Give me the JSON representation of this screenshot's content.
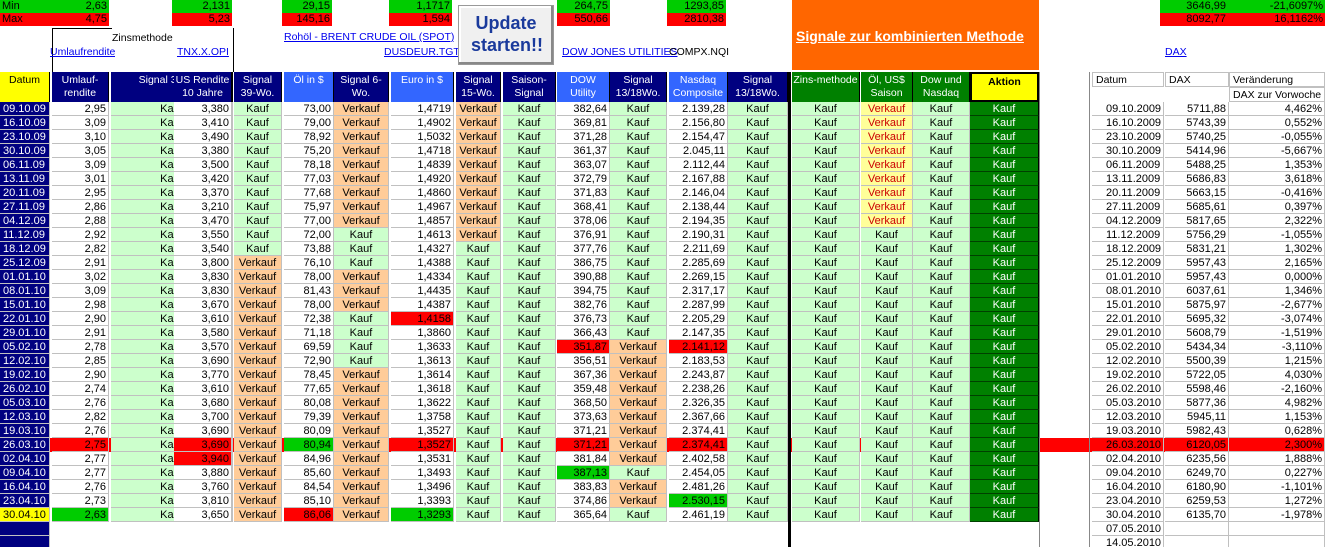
{
  "top": {
    "min_label": "Min",
    "max_label": "Max",
    "min_vals": [
      "2,63",
      "2,131",
      "29,15",
      "1,1717",
      "264,75",
      "1293,85",
      "3646,99",
      "-21,6097%"
    ],
    "max_vals": [
      "4,75",
      "5,23",
      "145,16",
      "1,594",
      "550,66",
      "2810,38",
      "8092,77",
      "16,1162%"
    ],
    "zins_label": "Zinsmethode",
    "links": [
      "Umlaufrendite",
      "TNX.X.OPI",
      "Rohöl - BRENT CRUDE OIL (SPOT)",
      "DUSDEUR.TGT",
      "DOW JONES UTILITIES",
      "COMPX.NQI",
      "DAX"
    ],
    "update_button_label": "Update starten!!",
    "signale_label": "Signale zur kombinierten Methode"
  },
  "headers": [
    "Datum",
    "Umlauf-rendite",
    "Signal 39-Wo.",
    "US Rendite 10 Jahre",
    "Signal 39-Wo.",
    "Öl in $",
    "Signal 6-Wo.",
    "Euro in $",
    "Signal 15-Wo.",
    "Saison-Signal",
    "DOW Utility",
    "Signal 13/18Wo.",
    "Nasdaq Composite",
    "Signal 13/18Wo.",
    "Zins-methode",
    "Öl, US$ Saison",
    "Dow und Nasdaq",
    "Aktion"
  ],
  "dax_headers": [
    "Datum",
    "DAX",
    "Veränderung",
    "DAX zur Vorwoche"
  ],
  "rows": [
    [
      "09.10.09",
      "2,95",
      "Kauf",
      "3,380",
      "Kauf",
      "73,00",
      "Verkauf",
      "1,4719",
      "Verkauf",
      "Kauf",
      "382,64",
      "Kauf",
      "2.139,28",
      "Kauf",
      "Kauf",
      "Verkauf",
      "Kauf",
      "Kauf"
    ],
    [
      "16.10.09",
      "3,09",
      "Kauf",
      "3,410",
      "Kauf",
      "79,00",
      "Verkauf",
      "1,4902",
      "Verkauf",
      "Kauf",
      "369,81",
      "Kauf",
      "2.156,80",
      "Kauf",
      "Kauf",
      "Verkauf",
      "Kauf",
      "Kauf"
    ],
    [
      "23.10.09",
      "3,10",
      "Kauf",
      "3,490",
      "Kauf",
      "78,92",
      "Verkauf",
      "1,5032",
      "Verkauf",
      "Kauf",
      "371,28",
      "Kauf",
      "2.154,47",
      "Kauf",
      "Kauf",
      "Verkauf",
      "Kauf",
      "Kauf"
    ],
    [
      "30.10.09",
      "3,05",
      "Kauf",
      "3,380",
      "Kauf",
      "75,20",
      "Verkauf",
      "1,4718",
      "Verkauf",
      "Kauf",
      "361,37",
      "Kauf",
      "2.045,11",
      "Kauf",
      "Kauf",
      "Verkauf",
      "Kauf",
      "Kauf"
    ],
    [
      "06.11.09",
      "3,09",
      "Kauf",
      "3,500",
      "Kauf",
      "78,18",
      "Verkauf",
      "1,4839",
      "Verkauf",
      "Kauf",
      "363,07",
      "Kauf",
      "2.112,44",
      "Kauf",
      "Kauf",
      "Verkauf",
      "Kauf",
      "Kauf"
    ],
    [
      "13.11.09",
      "3,01",
      "Kauf",
      "3,420",
      "Kauf",
      "77,03",
      "Verkauf",
      "1,4920",
      "Verkauf",
      "Kauf",
      "372,79",
      "Kauf",
      "2.167,88",
      "Kauf",
      "Kauf",
      "Verkauf",
      "Kauf",
      "Kauf"
    ],
    [
      "20.11.09",
      "2,95",
      "Kauf",
      "3,370",
      "Kauf",
      "77,68",
      "Verkauf",
      "1,4860",
      "Verkauf",
      "Kauf",
      "371,83",
      "Kauf",
      "2.146,04",
      "Kauf",
      "Kauf",
      "Verkauf",
      "Kauf",
      "Kauf"
    ],
    [
      "27.11.09",
      "2,86",
      "Kauf",
      "3,210",
      "Kauf",
      "75,97",
      "Verkauf",
      "1,4967",
      "Verkauf",
      "Kauf",
      "368,41",
      "Kauf",
      "2.138,44",
      "Kauf",
      "Kauf",
      "Verkauf",
      "Kauf",
      "Kauf"
    ],
    [
      "04.12.09",
      "2,88",
      "Kauf",
      "3,470",
      "Kauf",
      "77,00",
      "Verkauf",
      "1,4857",
      "Verkauf",
      "Kauf",
      "378,06",
      "Kauf",
      "2.194,35",
      "Kauf",
      "Kauf",
      "Verkauf",
      "Kauf",
      "Kauf"
    ],
    [
      "11.12.09",
      "2,92",
      "Kauf",
      "3,550",
      "Kauf",
      "72,00",
      "Kauf",
      "1,4613",
      "Verkauf",
      "Kauf",
      "376,91",
      "Kauf",
      "2.190,31",
      "Kauf",
      "Kauf",
      "Kauf",
      "Kauf",
      "Kauf"
    ],
    [
      "18.12.09",
      "2,82",
      "Kauf",
      "3,540",
      "Kauf",
      "73,88",
      "Kauf",
      "1,4327",
      "Kauf",
      "Kauf",
      "377,76",
      "Kauf",
      "2.211,69",
      "Kauf",
      "Kauf",
      "Kauf",
      "Kauf",
      "Kauf"
    ],
    [
      "25.12.09",
      "2,91",
      "Kauf",
      "3,800",
      "Verkauf",
      "76,10",
      "Kauf",
      "1,4388",
      "Kauf",
      "Kauf",
      "386,75",
      "Kauf",
      "2.285,69",
      "Kauf",
      "Kauf",
      "Kauf",
      "Kauf",
      "Kauf"
    ],
    [
      "01.01.10",
      "3,02",
      "Kauf",
      "3,830",
      "Verkauf",
      "78,00",
      "Verkauf",
      "1,4334",
      "Kauf",
      "Kauf",
      "390,88",
      "Kauf",
      "2.269,15",
      "Kauf",
      "Kauf",
      "Kauf",
      "Kauf",
      "Kauf"
    ],
    [
      "08.01.10",
      "3,09",
      "Kauf",
      "3,830",
      "Verkauf",
      "81,43",
      "Verkauf",
      "1,4435",
      "Kauf",
      "Kauf",
      "394,75",
      "Kauf",
      "2.317,17",
      "Kauf",
      "Kauf",
      "Kauf",
      "Kauf",
      "Kauf"
    ],
    [
      "15.01.10",
      "2,98",
      "Kauf",
      "3,670",
      "Verkauf",
      "78,00",
      "Verkauf",
      "1,4387",
      "Kauf",
      "Kauf",
      "382,76",
      "Kauf",
      "2.287,99",
      "Kauf",
      "Kauf",
      "Kauf",
      "Kauf",
      "Kauf"
    ],
    [
      "22.01.10",
      "2,90",
      "Kauf",
      "3,610",
      "Verkauf",
      "72,38",
      "Kauf",
      "1,4158",
      "Kauf",
      "Kauf",
      "376,73",
      "Kauf",
      "2.205,29",
      "Kauf",
      "Kauf",
      "Kauf",
      "Kauf",
      "Kauf"
    ],
    [
      "29.01.10",
      "2,91",
      "Kauf",
      "3,580",
      "Verkauf",
      "71,18",
      "Kauf",
      "1,3860",
      "Kauf",
      "Kauf",
      "366,43",
      "Kauf",
      "2.147,35",
      "Kauf",
      "Kauf",
      "Kauf",
      "Kauf",
      "Kauf"
    ],
    [
      "05.02.10",
      "2,78",
      "Kauf",
      "3,570",
      "Verkauf",
      "69,59",
      "Kauf",
      "1,3633",
      "Kauf",
      "Kauf",
      "351,87",
      "Verkauf",
      "2.141,12",
      "Kauf",
      "Kauf",
      "Kauf",
      "Kauf",
      "Kauf"
    ],
    [
      "12.02.10",
      "2,85",
      "Kauf",
      "3,690",
      "Verkauf",
      "72,90",
      "Kauf",
      "1,3613",
      "Kauf",
      "Kauf",
      "356,51",
      "Verkauf",
      "2.183,53",
      "Kauf",
      "Kauf",
      "Kauf",
      "Kauf",
      "Kauf"
    ],
    [
      "19.02.10",
      "2,90",
      "Kauf",
      "3,770",
      "Verkauf",
      "78,45",
      "Verkauf",
      "1,3614",
      "Kauf",
      "Kauf",
      "367,36",
      "Verkauf",
      "2.243,87",
      "Kauf",
      "Kauf",
      "Kauf",
      "Kauf",
      "Kauf"
    ],
    [
      "26.02.10",
      "2,74",
      "Kauf",
      "3,610",
      "Verkauf",
      "77,65",
      "Verkauf",
      "1,3618",
      "Kauf",
      "Kauf",
      "359,48",
      "Verkauf",
      "2.238,26",
      "Kauf",
      "Kauf",
      "Kauf",
      "Kauf",
      "Kauf"
    ],
    [
      "05.03.10",
      "2,76",
      "Kauf",
      "3,680",
      "Verkauf",
      "80,08",
      "Verkauf",
      "1,3622",
      "Kauf",
      "Kauf",
      "368,50",
      "Verkauf",
      "2.326,35",
      "Kauf",
      "Kauf",
      "Kauf",
      "Kauf",
      "Kauf"
    ],
    [
      "12.03.10",
      "2,82",
      "Kauf",
      "3,700",
      "Verkauf",
      "79,39",
      "Verkauf",
      "1,3758",
      "Kauf",
      "Kauf",
      "373,63",
      "Verkauf",
      "2.367,66",
      "Kauf",
      "Kauf",
      "Kauf",
      "Kauf",
      "Kauf"
    ],
    [
      "19.03.10",
      "2,76",
      "Kauf",
      "3,690",
      "Verkauf",
      "80,09",
      "Verkauf",
      "1,3527",
      "Kauf",
      "Kauf",
      "371,21",
      "Verkauf",
      "2.374,41",
      "Kauf",
      "Kauf",
      "Kauf",
      "Kauf",
      "Kauf"
    ],
    [
      "26.03.10",
      "2,75",
      "Kauf",
      "3,690",
      "Verkauf",
      "80,94",
      "Verkauf",
      "1,3527",
      "Kauf",
      "Kauf",
      "371,21",
      "Verkauf",
      "2.374,41",
      "Kauf",
      "Kauf",
      "Kauf",
      "Kauf",
      "Kauf"
    ],
    [
      "02.04.10",
      "2,77",
      "Kauf",
      "3,940",
      "Verkauf",
      "84,96",
      "Verkauf",
      "1,3531",
      "Kauf",
      "Kauf",
      "381,84",
      "Verkauf",
      "2.402,58",
      "Kauf",
      "Kauf",
      "Kauf",
      "Kauf",
      "Kauf"
    ],
    [
      "09.04.10",
      "2,77",
      "Kauf",
      "3,880",
      "Verkauf",
      "85,60",
      "Verkauf",
      "1,3493",
      "Kauf",
      "Kauf",
      "387,13",
      "Kauf",
      "2.454,05",
      "Kauf",
      "Kauf",
      "Kauf",
      "Kauf",
      "Kauf"
    ],
    [
      "16.04.10",
      "2,76",
      "Kauf",
      "3,760",
      "Verkauf",
      "84,54",
      "Verkauf",
      "1,3496",
      "Kauf",
      "Kauf",
      "383,83",
      "Verkauf",
      "2.481,26",
      "Kauf",
      "Kauf",
      "Kauf",
      "Kauf",
      "Kauf"
    ],
    [
      "23.04.10",
      "2,73",
      "Kauf",
      "3,810",
      "Verkauf",
      "85,10",
      "Verkauf",
      "1,3393",
      "Kauf",
      "Kauf",
      "374,86",
      "Verkauf",
      "2.530,15",
      "Kauf",
      "Kauf",
      "Kauf",
      "Kauf",
      "Kauf"
    ],
    [
      "30.04.10",
      "2,63",
      "Kauf",
      "3,650",
      "Verkauf",
      "86,06",
      "Verkauf",
      "1,3293",
      "Kauf",
      "Kauf",
      "365,64",
      "Kauf",
      "2.461,19",
      "Kauf",
      "Kauf",
      "Kauf",
      "Kauf",
      "Kauf"
    ]
  ],
  "dax_rows": [
    [
      "09.10.2009",
      "5711,88",
      "4,462%"
    ],
    [
      "16.10.2009",
      "5743,39",
      "0,552%"
    ],
    [
      "23.10.2009",
      "5740,25",
      "-0,055%"
    ],
    [
      "30.10.2009",
      "5414,96",
      "-5,667%"
    ],
    [
      "06.11.2009",
      "5488,25",
      "1,353%"
    ],
    [
      "13.11.2009",
      "5686,83",
      "3,618%"
    ],
    [
      "20.11.2009",
      "5663,15",
      "-0,416%"
    ],
    [
      "27.11.2009",
      "5685,61",
      "0,397%"
    ],
    [
      "04.12.2009",
      "5817,65",
      "2,322%"
    ],
    [
      "11.12.2009",
      "5756,29",
      "-1,055%"
    ],
    [
      "18.12.2009",
      "5831,21",
      "1,302%"
    ],
    [
      "25.12.2009",
      "5957,43",
      "2,165%"
    ],
    [
      "01.01.2010",
      "5957,43",
      "0,000%"
    ],
    [
      "08.01.2010",
      "6037,61",
      "1,346%"
    ],
    [
      "15.01.2010",
      "5875,97",
      "-2,677%"
    ],
    [
      "22.01.2010",
      "5695,32",
      "-3,074%"
    ],
    [
      "29.01.2010",
      "5608,79",
      "-1,519%"
    ],
    [
      "05.02.2010",
      "5434,34",
      "-3,110%"
    ],
    [
      "12.02.2010",
      "5500,39",
      "1,215%"
    ],
    [
      "19.02.2010",
      "5722,05",
      "4,030%"
    ],
    [
      "26.02.2010",
      "5598,46",
      "-2,160%"
    ],
    [
      "05.03.2010",
      "5877,36",
      "4,982%"
    ],
    [
      "12.03.2010",
      "5945,11",
      "1,153%"
    ],
    [
      "19.03.2010",
      "5982,43",
      "0,628%"
    ],
    [
      "26.03.2010",
      "6120,05",
      "2,300%"
    ],
    [
      "02.04.2010",
      "6235,56",
      "1,888%"
    ],
    [
      "09.04.2010",
      "6249,70",
      "0,227%"
    ],
    [
      "16.04.2010",
      "6180,90",
      "-1,101%"
    ],
    [
      "23.04.2010",
      "6259,53",
      "1,272%"
    ],
    [
      "30.04.2010",
      "6135,70",
      "-1,978%"
    ],
    [
      "07.05.2010",
      "",
      ""
    ],
    [
      "14.05.2010",
      "",
      ""
    ]
  ],
  "colors": {
    "buy_bg": "#ccffcc",
    "sell_bg": "#ffcc99",
    "aktion_bg": "#008000",
    "header_bg": "#000080",
    "oel_header": "#3366ff",
    "highlight_red": "#ff0000",
    "highlight_green": "#00cc00",
    "signal_banner": "#ff6600"
  }
}
